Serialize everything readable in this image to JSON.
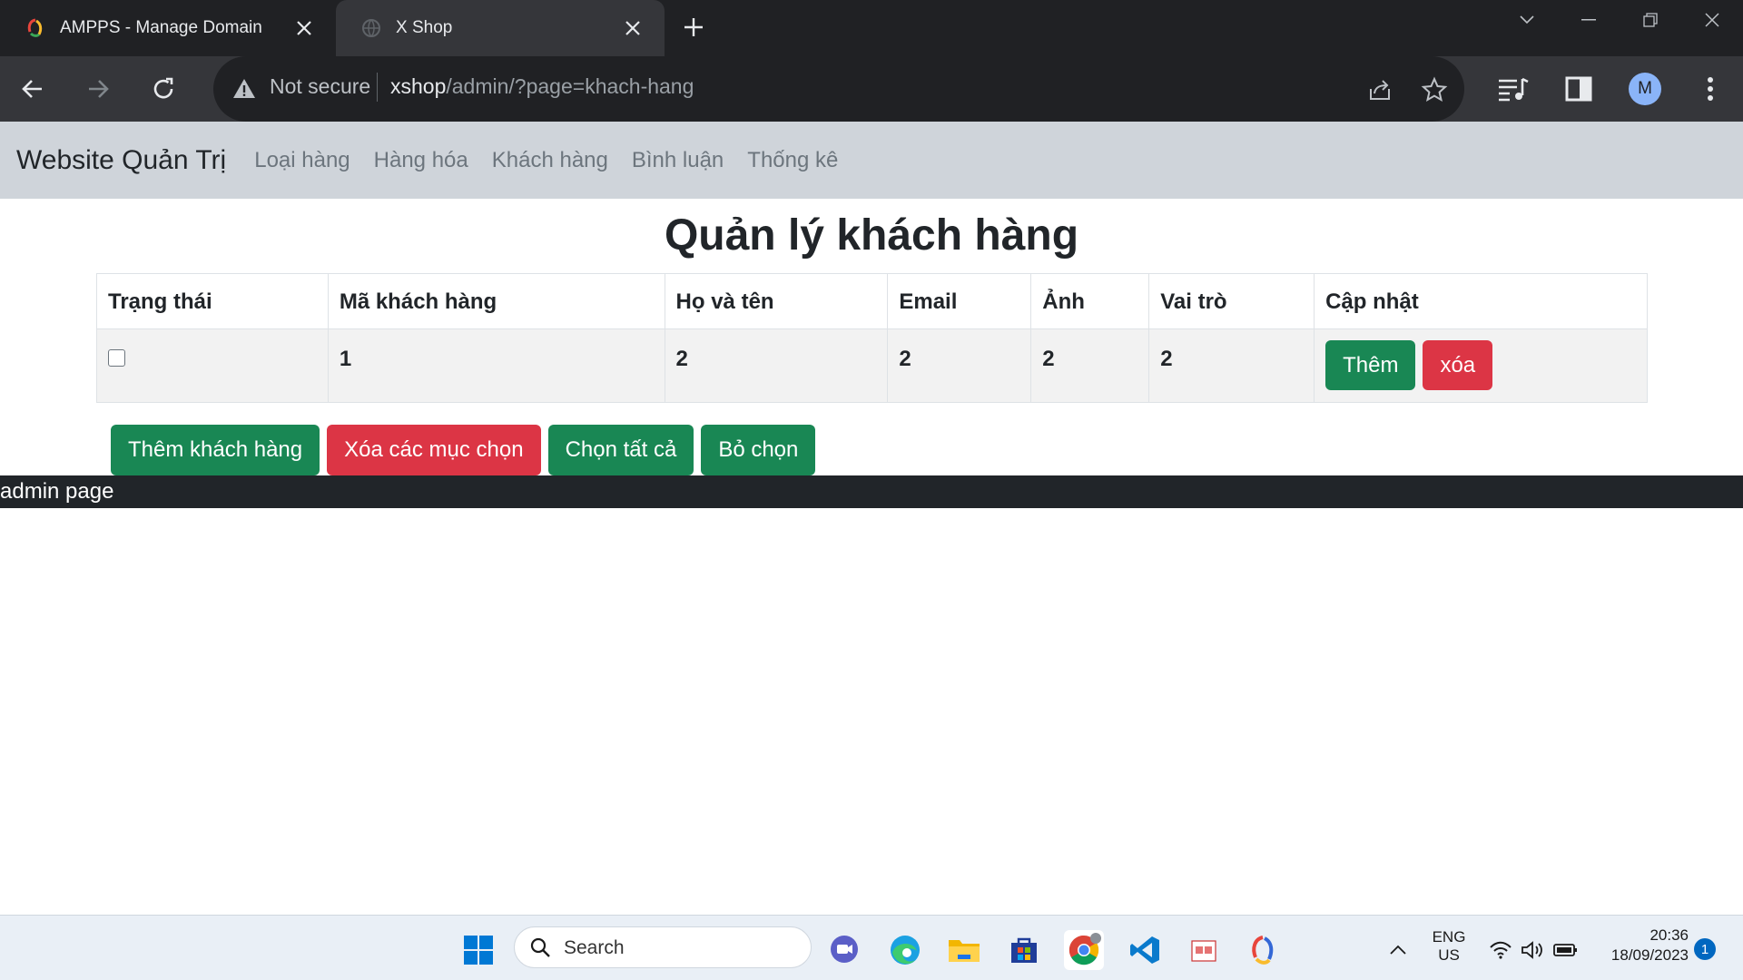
{
  "browser": {
    "tabs": [
      {
        "title": "AMPPS - Manage Domain",
        "active": false
      },
      {
        "title": "X Shop",
        "active": true
      }
    ],
    "address": {
      "security_label": "Not secure",
      "host": "xshop",
      "path": "/admin/?page=khach-hang"
    },
    "profile_initial": "M"
  },
  "navbar": {
    "brand": "Website Quản Trị",
    "links": [
      "Loại hàng",
      "Hàng hóa",
      "Khách hàng",
      "Bình luận",
      "Thống kê"
    ]
  },
  "page_title": "Quản lý khách hàng",
  "table": {
    "headers": [
      "Trạng thái",
      "Mã khách hàng",
      "Họ và tên",
      "Email",
      "Ảnh",
      "Vai trò",
      "Cập nhật"
    ],
    "rows": [
      {
        "checked": false,
        "ma_kh": "1",
        "ho_ten": "2",
        "email": "2",
        "anh": "2",
        "vai_tro": "2",
        "edit_label": "Thêm",
        "delete_label": "xóa"
      }
    ]
  },
  "bulk_actions": {
    "add": "Thêm khách hàng",
    "delete_selected": "Xóa các mục chọn",
    "select_all": "Chọn tất cả",
    "deselect": "Bỏ chọn"
  },
  "footer": "admin page",
  "taskbar": {
    "search_placeholder": "Search",
    "language": "ENG",
    "region": "US",
    "time": "20:36",
    "date": "18/09/2023",
    "notification_count": "1"
  },
  "colors": {
    "success": "#198754",
    "danger": "#dc3545",
    "navbar_bg": "#cfd4da",
    "footer_bg": "#212529"
  }
}
